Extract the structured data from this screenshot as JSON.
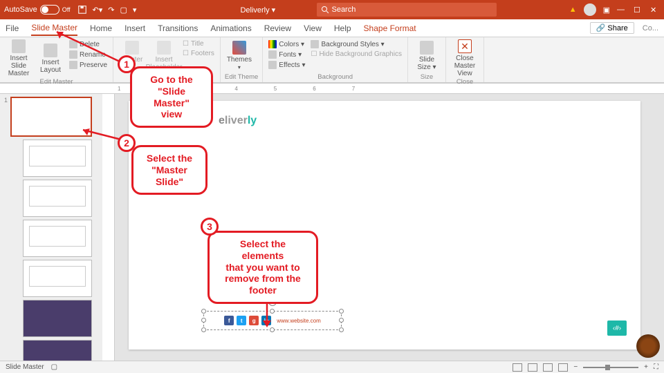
{
  "titlebar": {
    "autosave": "AutoSave",
    "off": "Off",
    "doc": "Deliverly ▾",
    "search_ph": "Search"
  },
  "tabs": {
    "file": "File",
    "slidemaster": "Slide Master",
    "home": "Home",
    "insert": "Insert",
    "transitions": "Transitions",
    "animations": "Animations",
    "review": "Review",
    "view": "View",
    "help": "Help",
    "shapefmt": "Shape Format",
    "share": "Share",
    "comments": "Co..."
  },
  "ribbon": {
    "edit_master": {
      "label": "Edit Master",
      "insert_slide": "Insert Slide\nMaster",
      "insert_layout": "Insert\nLayout",
      "delete": "Delete",
      "rename": "Rename",
      "preserve": "Preserve"
    },
    "master_layout": {
      "label": "Master Layout",
      "master": "Master\nLa...",
      "placeholder": "Insert\nPlaceholder",
      "title": "Title",
      "footers": "Footers"
    },
    "edit_theme": {
      "label": "Edit Theme",
      "themes": "Themes"
    },
    "background": {
      "label": "Background",
      "colors": "Colors ▾",
      "fonts": "Fonts ▾",
      "effects": "Effects ▾",
      "styles": "Background Styles ▾",
      "hide": "Hide Background Graphics"
    },
    "size": {
      "label": "Size",
      "slide_size": "Slide\nSize ▾"
    },
    "close": {
      "label": "Close",
      "close_view": "Close\nMaster View"
    }
  },
  "ruler": "1234567",
  "slide": {
    "logo1": "e",
    "logo2": "liver",
    "logo3": "ly",
    "website": "www.website.com"
  },
  "callouts": {
    "c1": "Go to the\n\"Slide Master\"\nview",
    "c2": "Select the\n\"Master Slide\"",
    "c3": "Select the elements\nthat you want to\nremove from the\nfooter",
    "n1": "1",
    "n2": "2",
    "n3": "3"
  },
  "status": {
    "mode": "Slide Master",
    "zoom": "+",
    "zoomout": "−"
  }
}
